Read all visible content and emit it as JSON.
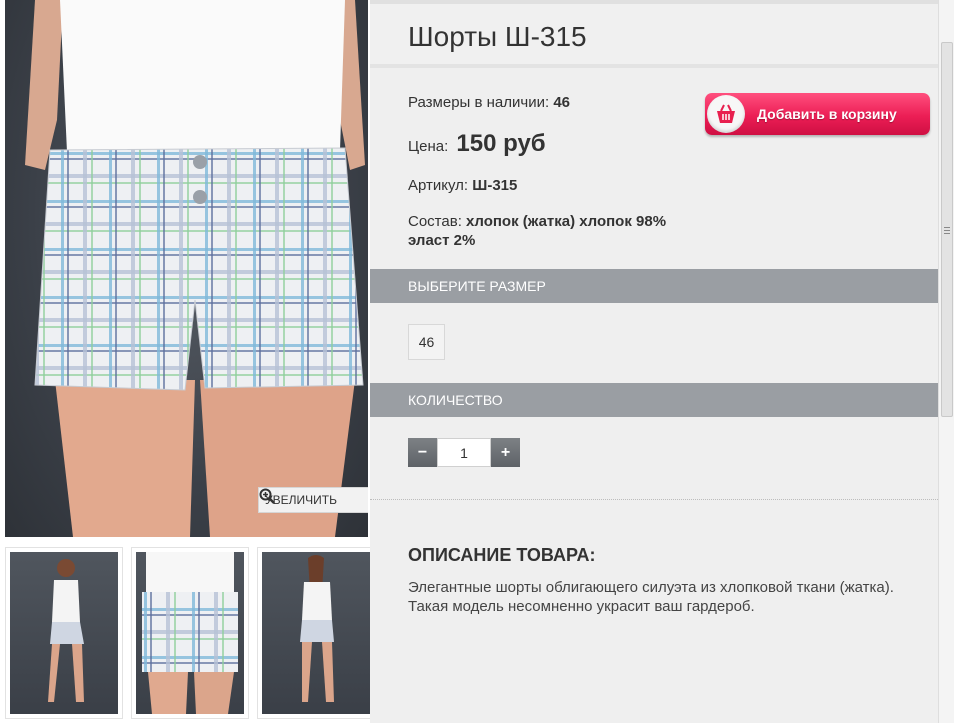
{
  "product": {
    "title": "Шорты Ш-315",
    "sizes_label": "Размеры в наличии:",
    "sizes_value": "46",
    "price_label": "Цена:",
    "price_value": "150 руб",
    "sku_label": "Артикул:",
    "sku_value": "Ш-315",
    "composition_label": "Состав:",
    "composition_value": "хлопок (жатка) хлопок 98% эласт 2%"
  },
  "cart": {
    "label": "Добавить в корзину",
    "icon": "basket-icon",
    "color": "#ec1e55"
  },
  "gallery": {
    "zoom_label": "УВЕЛИЧИТЬ",
    "zoom_icon": "magnifier-plus-icon",
    "thumbnail_count": 3
  },
  "size_section": {
    "header": "ВЫБЕРИТЕ РАЗМЕР",
    "options": [
      "46"
    ]
  },
  "quantity_section": {
    "header": "КОЛИЧЕСТВО",
    "minus": "−",
    "plus": "+",
    "value": "1"
  },
  "description": {
    "title": "ОПИСАНИЕ ТОВАРА:",
    "text": "Элегантные шорты облигающего силуэта из хлопковой ткани (жатка). Такая модель несомненно украсит ваш гардероб."
  }
}
